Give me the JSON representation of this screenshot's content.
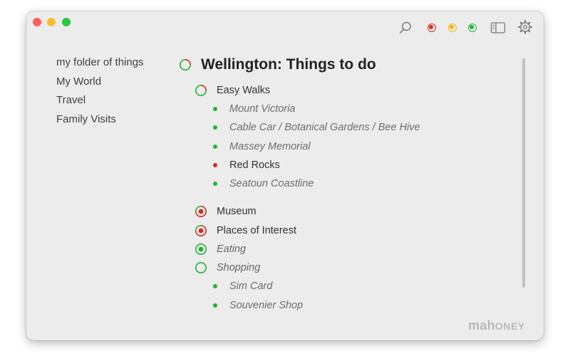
{
  "colors": {
    "accent_red": "#cf2d1f",
    "accent_yellow": "#f4b400",
    "accent_green": "#21b23a",
    "window_bg": "#ececec"
  },
  "toolbar": {
    "search_icon": "magnifier-icon",
    "filters": [
      {
        "name": "red",
        "color": "#cf2d1f"
      },
      {
        "name": "yellow",
        "color": "#f4b400"
      },
      {
        "name": "green",
        "color": "#21b23a"
      }
    ],
    "sidebar_toggle_icon": "sidebar-toggle-icon",
    "settings_icon": "gear-icon"
  },
  "sidebar": {
    "items": [
      {
        "label": "my folder of things"
      },
      {
        "label": "My World"
      },
      {
        "label": "Travel"
      },
      {
        "label": "Family Visits"
      }
    ]
  },
  "main": {
    "title": "Wellington: Things to do",
    "items": [
      {
        "label": "Easy Walks",
        "status": "green-red"
      },
      {
        "label": "Mount Victoria",
        "status": "green"
      },
      {
        "label": "Cable Car / Botanical Gardens / Bee Hive",
        "status": "green"
      },
      {
        "label": "Massey Memorial",
        "status": "green"
      },
      {
        "label": "Red Rocks",
        "status": "red"
      },
      {
        "label": "Seatoun Coastline",
        "status": "green"
      },
      {
        "label": "Museum",
        "status": "red-green"
      },
      {
        "label": "Places of Interest",
        "status": "red-green"
      },
      {
        "label": "Eating",
        "status": "green"
      },
      {
        "label": "Shopping",
        "status": "green-empty"
      },
      {
        "label": "Sim Card",
        "status": "green"
      },
      {
        "label": "Souvenier Shop",
        "status": "green"
      }
    ]
  },
  "branding": {
    "prefix": "mah",
    "suffix": "ONEY"
  }
}
